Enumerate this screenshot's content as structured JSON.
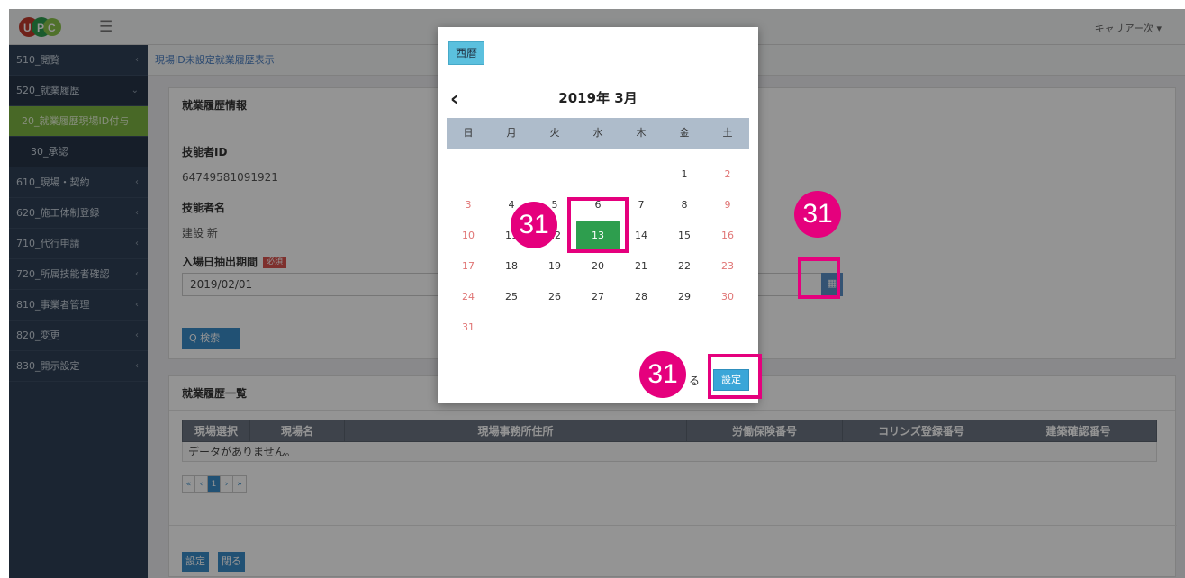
{
  "header": {
    "logo_text": "UPC",
    "menu_icon": "hamburger-icon",
    "user_menu": "キャリアー次 ▾"
  },
  "sidebar": {
    "items": [
      {
        "label": "510_閲覧"
      },
      {
        "label": "520_就業履歴"
      },
      {
        "label": "20_就業履歴現場ID付与"
      },
      {
        "label": "30_承認"
      },
      {
        "label": "610_現場・契約"
      },
      {
        "label": "620_施工体制登録"
      },
      {
        "label": "710_代行申請"
      },
      {
        "label": "720_所属技能者確認"
      },
      {
        "label": "810_事業者管理"
      },
      {
        "label": "820_変更"
      },
      {
        "label": "830_開示設定"
      }
    ]
  },
  "breadcrumb": "現場ID未設定就業履歴表示",
  "info_panel": {
    "title": "就業履歴情報",
    "worker_id_label": "技能者ID",
    "worker_id_value": "64749581091921",
    "worker_name_label": "技能者名",
    "worker_name_value": "建設 新",
    "period_label": "入場日抽出期間",
    "required_badge": "必須",
    "period_start": "2019/02/01",
    "search_button": "Q 検索"
  },
  "list_panel": {
    "title": "就業履歴一覧",
    "columns": [
      "現場選択",
      "現場名",
      "現場事務所住所",
      "労働保険番号",
      "コリンズ登録番号",
      "建築確認番号"
    ],
    "empty_text": "データがありません。",
    "pager": [
      "«",
      "‹",
      "1",
      "›",
      "»"
    ],
    "set_button": "設定",
    "close_button": "閉る"
  },
  "calendar_modal": {
    "era_button": "西暦",
    "prev_icon": "chevron-left-icon",
    "month_title": "2019年 3月",
    "weekdays": [
      "日",
      "月",
      "火",
      "水",
      "木",
      "金",
      "土"
    ],
    "days": [
      "1",
      "2",
      "3",
      "4",
      "5",
      "6",
      "7",
      "8",
      "9",
      "10",
      "11",
      "12",
      "13",
      "14",
      "15",
      "16",
      "17",
      "18",
      "19",
      "20",
      "21",
      "22",
      "23",
      "24",
      "25",
      "26",
      "27",
      "28",
      "29",
      "30",
      "31"
    ],
    "selected_day": "13",
    "close_text": "る",
    "set_button": "設定"
  },
  "annotations": {
    "step_number": "31",
    "highlight_color": "#e5007d"
  },
  "colors": {
    "sidebar": "#2f4056",
    "active_nav": "#7cb342",
    "selected_day": "#2e9e4e",
    "primary_button": "#3a8cc8"
  }
}
